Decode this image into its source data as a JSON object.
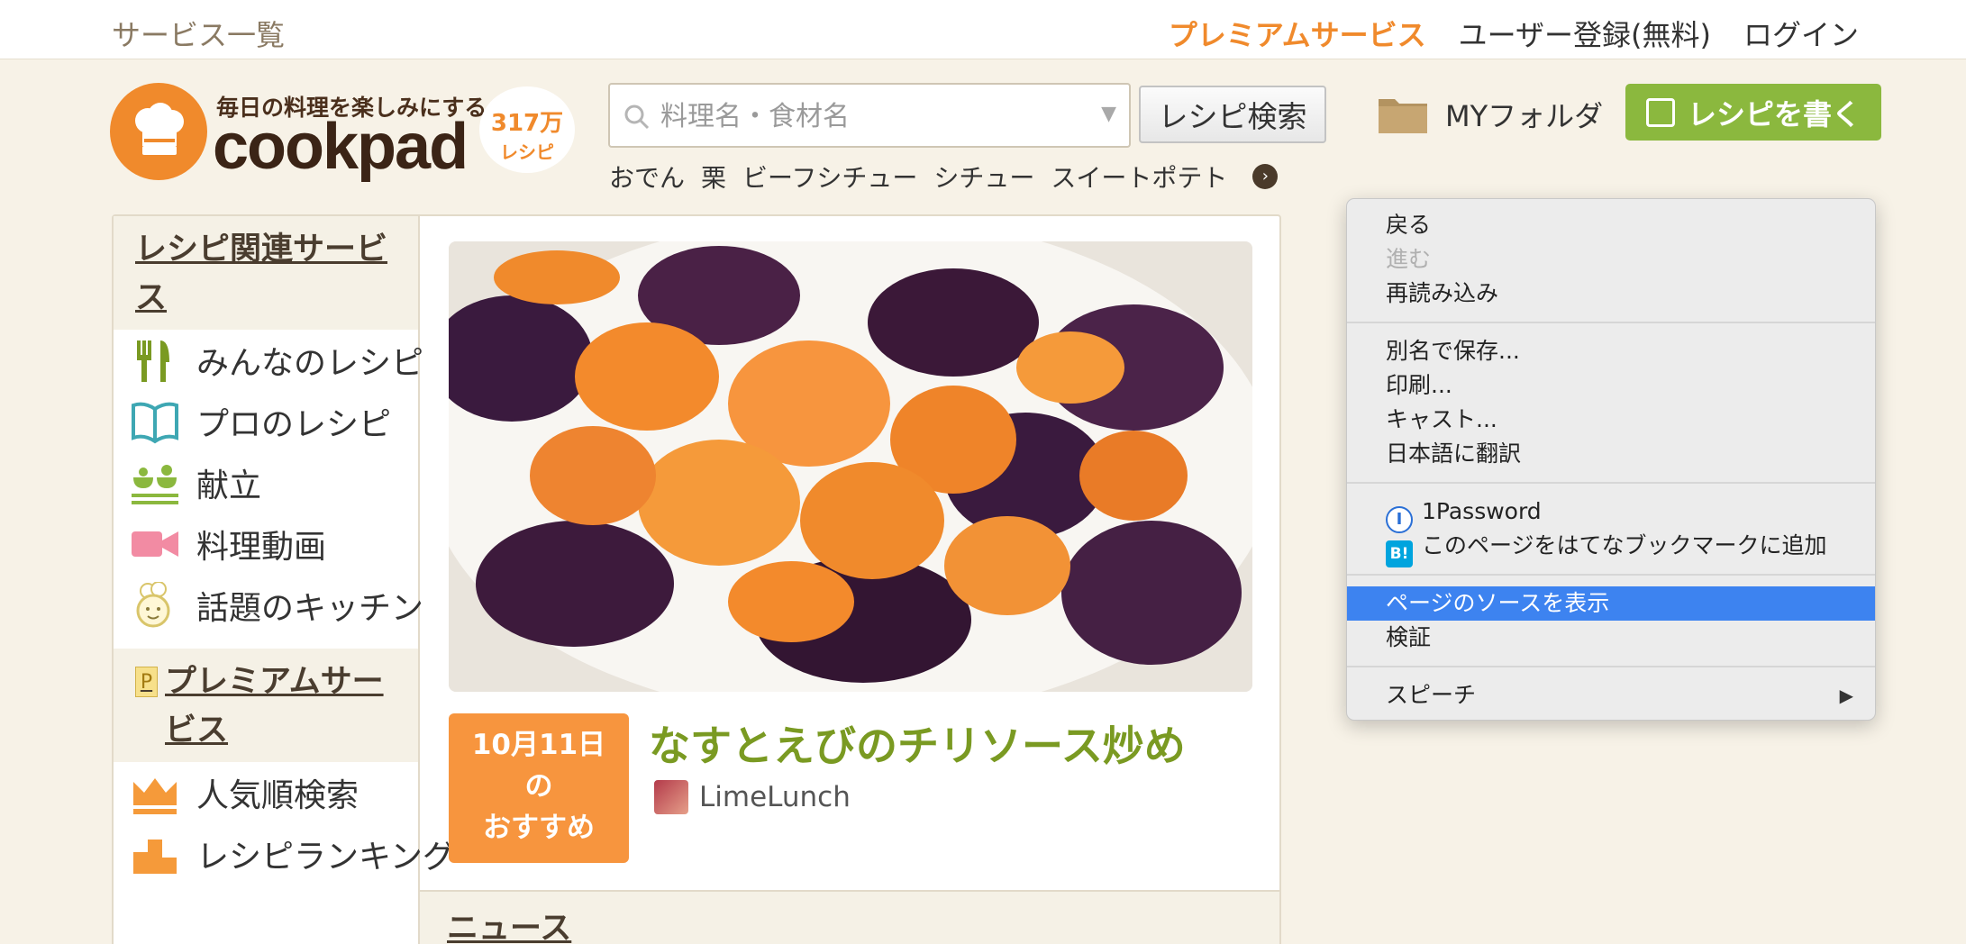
{
  "topbar": {
    "services": "サービス一覧",
    "premium": "プレミアムサービス",
    "register": "ユーザー登録(無料)",
    "login": "ログイン"
  },
  "header": {
    "tagline": "毎日の料理を楽しみにする",
    "logo": "cookpad",
    "recipe_count": "317万",
    "recipe_unit": "レシピ",
    "search_placeholder": "料理名・食材名",
    "search_button": "レシピ検索",
    "keywords": [
      "おでん",
      "栗",
      "ビーフシチュー",
      "シチュー",
      "スイートポテト"
    ],
    "my_folder": "MYフォルダ",
    "write_recipe": "レシピを書く"
  },
  "sidebar": {
    "recipe_services_title": "レシピ関連サービス",
    "items": [
      {
        "label": "みんなのレシピ",
        "icon": "fork-knife-icon"
      },
      {
        "label": "プロのレシピ",
        "icon": "book-icon"
      },
      {
        "label": "献立",
        "icon": "menu-bowl-icon"
      },
      {
        "label": "料理動画",
        "icon": "video-camera-icon"
      },
      {
        "label": "話題のキッチン",
        "icon": "chef-face-icon"
      }
    ],
    "premium_badge": "P",
    "premium_title": "プレミアムサービス",
    "premium_items": [
      {
        "label": "人気順検索",
        "icon": "crown-icon"
      },
      {
        "label": "レシピランキング",
        "icon": "podium-icon"
      }
    ]
  },
  "feature": {
    "date": "10月11日",
    "date_suffix": "の",
    "date_label": "おすすめ",
    "title": "なすとえびのチリソース炒め",
    "author": "LimeLunch"
  },
  "news": {
    "title": "ニュース"
  },
  "context_menu": {
    "back": "戻る",
    "forward": "進む",
    "reload": "再読み込み",
    "save_as": "別名で保存...",
    "print": "印刷...",
    "cast": "キャスト...",
    "translate": "日本語に翻訳",
    "onepassword": "1Password",
    "onepassword_icon": "I",
    "hatena_icon": "B!",
    "hatena": "このページをはてなブックマークに追加",
    "view_source": "ページのソースを表示",
    "inspect": "検証",
    "speech": "スピーチ"
  },
  "colors": {
    "accent_orange": "#f08a2c",
    "accent_green": "#8bb83e",
    "menu_highlight": "#3d83f0"
  }
}
